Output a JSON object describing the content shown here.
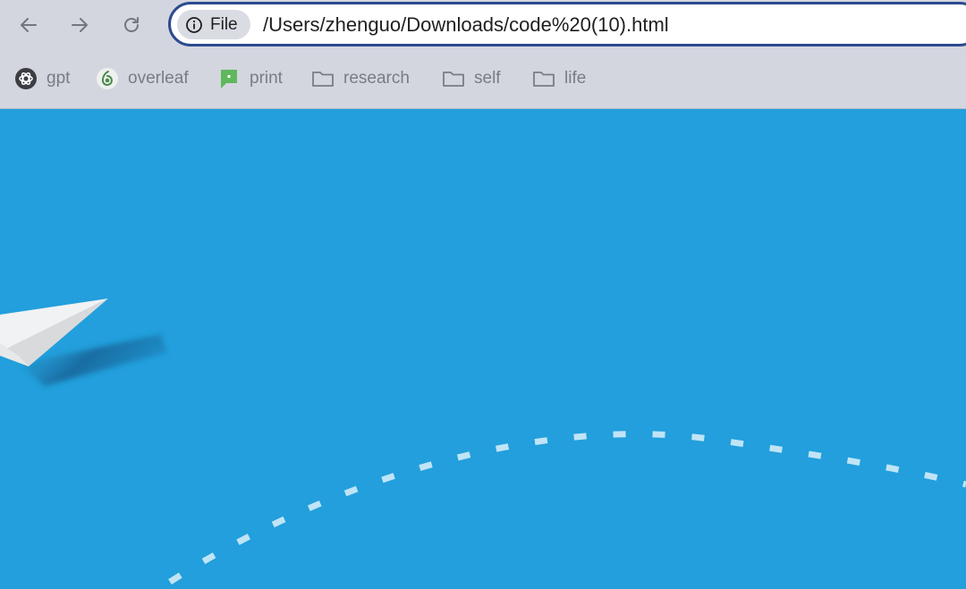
{
  "toolbar": {
    "back_icon": "arrow-left-icon",
    "forward_icon": "arrow-right-icon",
    "reload_icon": "reload-icon"
  },
  "omnibox": {
    "chip_label": "File",
    "chip_icon": "info-icon",
    "url": "/Users/zhenguo/Downloads/code%20(10).html"
  },
  "bookmarks": [
    {
      "label": "gpt",
      "icon": "openai-icon"
    },
    {
      "label": "overleaf",
      "icon": "overleaf-icon"
    },
    {
      "label": "print",
      "icon": "chat-bubble-icon"
    },
    {
      "label": "research",
      "icon": "folder-icon"
    },
    {
      "label": "self",
      "icon": "folder-icon"
    },
    {
      "label": "life",
      "icon": "folder-icon"
    }
  ],
  "colors": {
    "chrome_bg": "#d4d6df",
    "omnibox_border": "#2c4a8f",
    "page_bg": "#229fdc",
    "dash_color": "#bfe4f6",
    "plane_white": "#f1f2f3",
    "print_green": "#5fb85c"
  }
}
